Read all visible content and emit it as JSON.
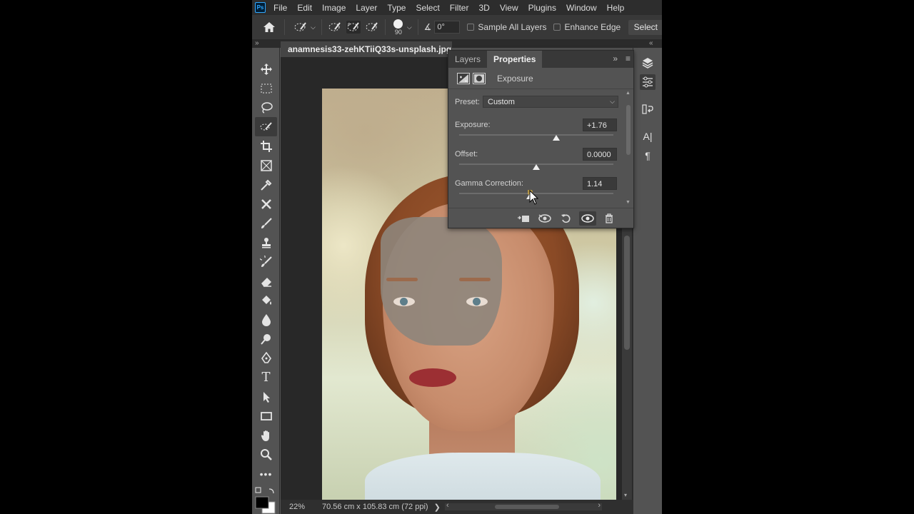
{
  "app": {
    "logo_text": "Ps",
    "menu": [
      "File",
      "Edit",
      "Image",
      "Layer",
      "Type",
      "Select",
      "Filter",
      "3D",
      "View",
      "Plugins",
      "Window",
      "Help"
    ]
  },
  "options_bar": {
    "brush_size": "90",
    "angle": "0°",
    "sample_all_layers": "Sample All Layers",
    "enhance_edge": "Enhance Edge",
    "select_subject": "Select"
  },
  "document": {
    "tab_title": "anamnesis33-zehKTiiQ33s-unsplash.jpg @"
  },
  "properties_panel": {
    "tabs": [
      "Layers",
      "Properties"
    ],
    "active_tab": "Properties",
    "adjustment_title": "Exposure",
    "preset_label": "Preset:",
    "preset_value": "Custom",
    "sliders": [
      {
        "label": "Exposure:",
        "value": "+1.76",
        "position": 0.63
      },
      {
        "label": "Offset:",
        "value": "0.0000",
        "position": 0.5
      },
      {
        "label": "Gamma Correction:",
        "value": "1.14",
        "position": 0.46
      }
    ]
  },
  "status_bar": {
    "zoom": "22%",
    "dimensions": "70.56 cm x 105.83 cm (72 ppi)",
    "arrow": "❯",
    "scroll_left": "‹",
    "scroll_right": "›"
  },
  "icons": {
    "home": "home-icon",
    "quick_selection": "quick-selection-brush-icon",
    "layers_dock": "layers-icon",
    "adjustments_dock": "adjustments-icon",
    "history_dock": "history-icon",
    "character_dock": "character-icon",
    "paragraph_dock": "paragraph-icon"
  },
  "colors": {
    "panel_bg": "#535353",
    "menubar_bg": "#2d2d2d",
    "canvas_bg": "#282828",
    "accent": "#31a8ff"
  }
}
